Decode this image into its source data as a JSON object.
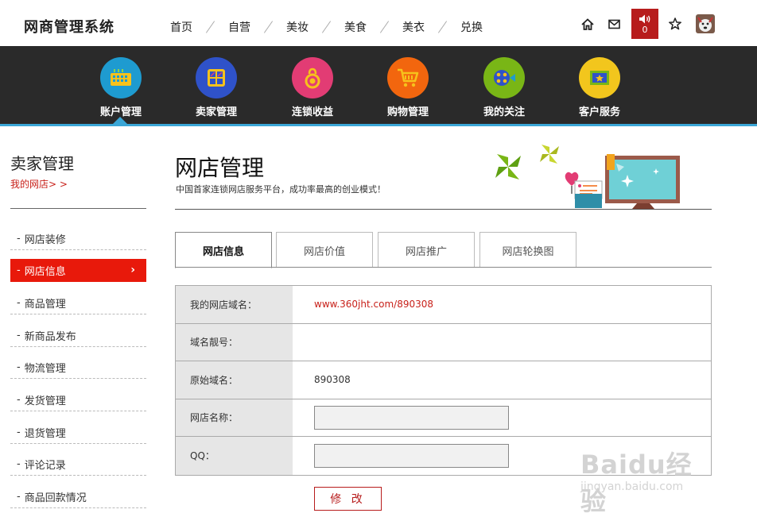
{
  "brand": "网商管理系统",
  "topnav": [
    "首页",
    "自营",
    "美妆",
    "美食",
    "美衣",
    "兑换"
  ],
  "sound_count": "0",
  "categories": [
    {
      "label": "账户管理",
      "color": "#1e9bd0",
      "icon": "keyboard-icon"
    },
    {
      "label": "卖家管理",
      "color": "#2f52c9",
      "icon": "grid-icon"
    },
    {
      "label": "连锁收益",
      "color": "#e23c74",
      "icon": "bag-icon"
    },
    {
      "label": "购物管理",
      "color": "#f2660e",
      "icon": "cart-icon"
    },
    {
      "label": "我的关注",
      "color": "#79b616",
      "icon": "eye-icon"
    },
    {
      "label": "客户服务",
      "color": "#f2c61d",
      "icon": "screen-icon"
    }
  ],
  "sidebar": {
    "title": "卖家管理",
    "subtitle": "我的网店> >",
    "items": [
      "网店装修",
      "网店信息",
      "商品管理",
      "新商品发布",
      "物流管理",
      "发货管理",
      "退货管理",
      "评论记录",
      "商品回款情况"
    ],
    "active_index": 1
  },
  "page": {
    "title": "网店管理",
    "subtitle": "中国首家连锁网店服务平台，成功率最高的创业模式！"
  },
  "tabs": [
    "网店信息",
    "网店价值",
    "网店推广",
    "网店轮换图"
  ],
  "form": {
    "rows": [
      {
        "label": "我的网店域名：",
        "value": "www.360jht.com/890308"
      },
      {
        "label": "域名靓号：",
        "value": ""
      },
      {
        "label": "原始域名：",
        "value": "890308"
      },
      {
        "label": "网店名称：",
        "value": ""
      },
      {
        "label": "QQ：",
        "value": ""
      }
    ],
    "submit_label": "修 改"
  },
  "watermark": {
    "line1": "Baidu经验",
    "line2": "jingyan.baidu.com"
  },
  "colors": {
    "accent_red": "#e8190b",
    "bar_dark": "#2a2a2a",
    "bar_line": "#3aa6d6"
  }
}
